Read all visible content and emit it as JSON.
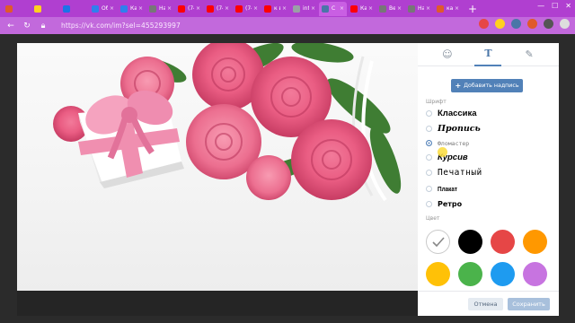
{
  "browser": {
    "tabs": [
      {
        "title": "",
        "color": "#e05a2b"
      },
      {
        "title": "",
        "color": "#ffd21f"
      },
      {
        "title": "",
        "color": "#1a73e8"
      },
      {
        "title": "Обі",
        "color": "#2f80ed"
      },
      {
        "title": "Кар",
        "color": "#2f80ed"
      },
      {
        "title": "Нас",
        "color": "#777777"
      },
      {
        "title": "(74)",
        "color": "#ff0000"
      },
      {
        "title": "(74)",
        "color": "#ff0000"
      },
      {
        "title": "(74)",
        "color": "#ff0000"
      },
      {
        "title": "к во",
        "color": "#ff0000"
      },
      {
        "title": "inte",
        "color": "#9aa0a6"
      },
      {
        "title": "С",
        "color": "#4a76a8"
      },
      {
        "title": "Как",
        "color": "#ff0000"
      },
      {
        "title": "Веб",
        "color": "#777777"
      },
      {
        "title": "Нас",
        "color": "#777777"
      },
      {
        "title": "кар",
        "color": "#e05a2b"
      }
    ],
    "active_tab_index": 11,
    "url": "https://vk.com/im?sel=455293997",
    "new_tab_label": "+"
  },
  "editor": {
    "tabs": [
      {
        "name": "sticker",
        "icon": "☺"
      },
      {
        "name": "text",
        "icon": "T"
      },
      {
        "name": "draw",
        "icon": "✎"
      }
    ],
    "active_tab": "text",
    "add_text_button": "Добавить надпись",
    "font_section_label": "Шрифт",
    "fonts": [
      {
        "label": "Классика",
        "selected": false
      },
      {
        "label": "Пропись",
        "selected": false
      },
      {
        "label": "Фломастер",
        "selected": true
      },
      {
        "label": "Курсив",
        "selected": false
      },
      {
        "label": "Печатный",
        "selected": false
      },
      {
        "label": "Плакат",
        "selected": false
      },
      {
        "label": "Ретро",
        "selected": false
      }
    ],
    "color_section_label": "Цвет",
    "colors": [
      "#ffffff",
      "#000000",
      "#e64646",
      "#ff9800",
      "#ffc107",
      "#4bb34b",
      "#1e9bf0",
      "#c774e0"
    ],
    "selected_color_index": 0,
    "cancel_button": "Отмена",
    "save_button": "Сохранить"
  }
}
